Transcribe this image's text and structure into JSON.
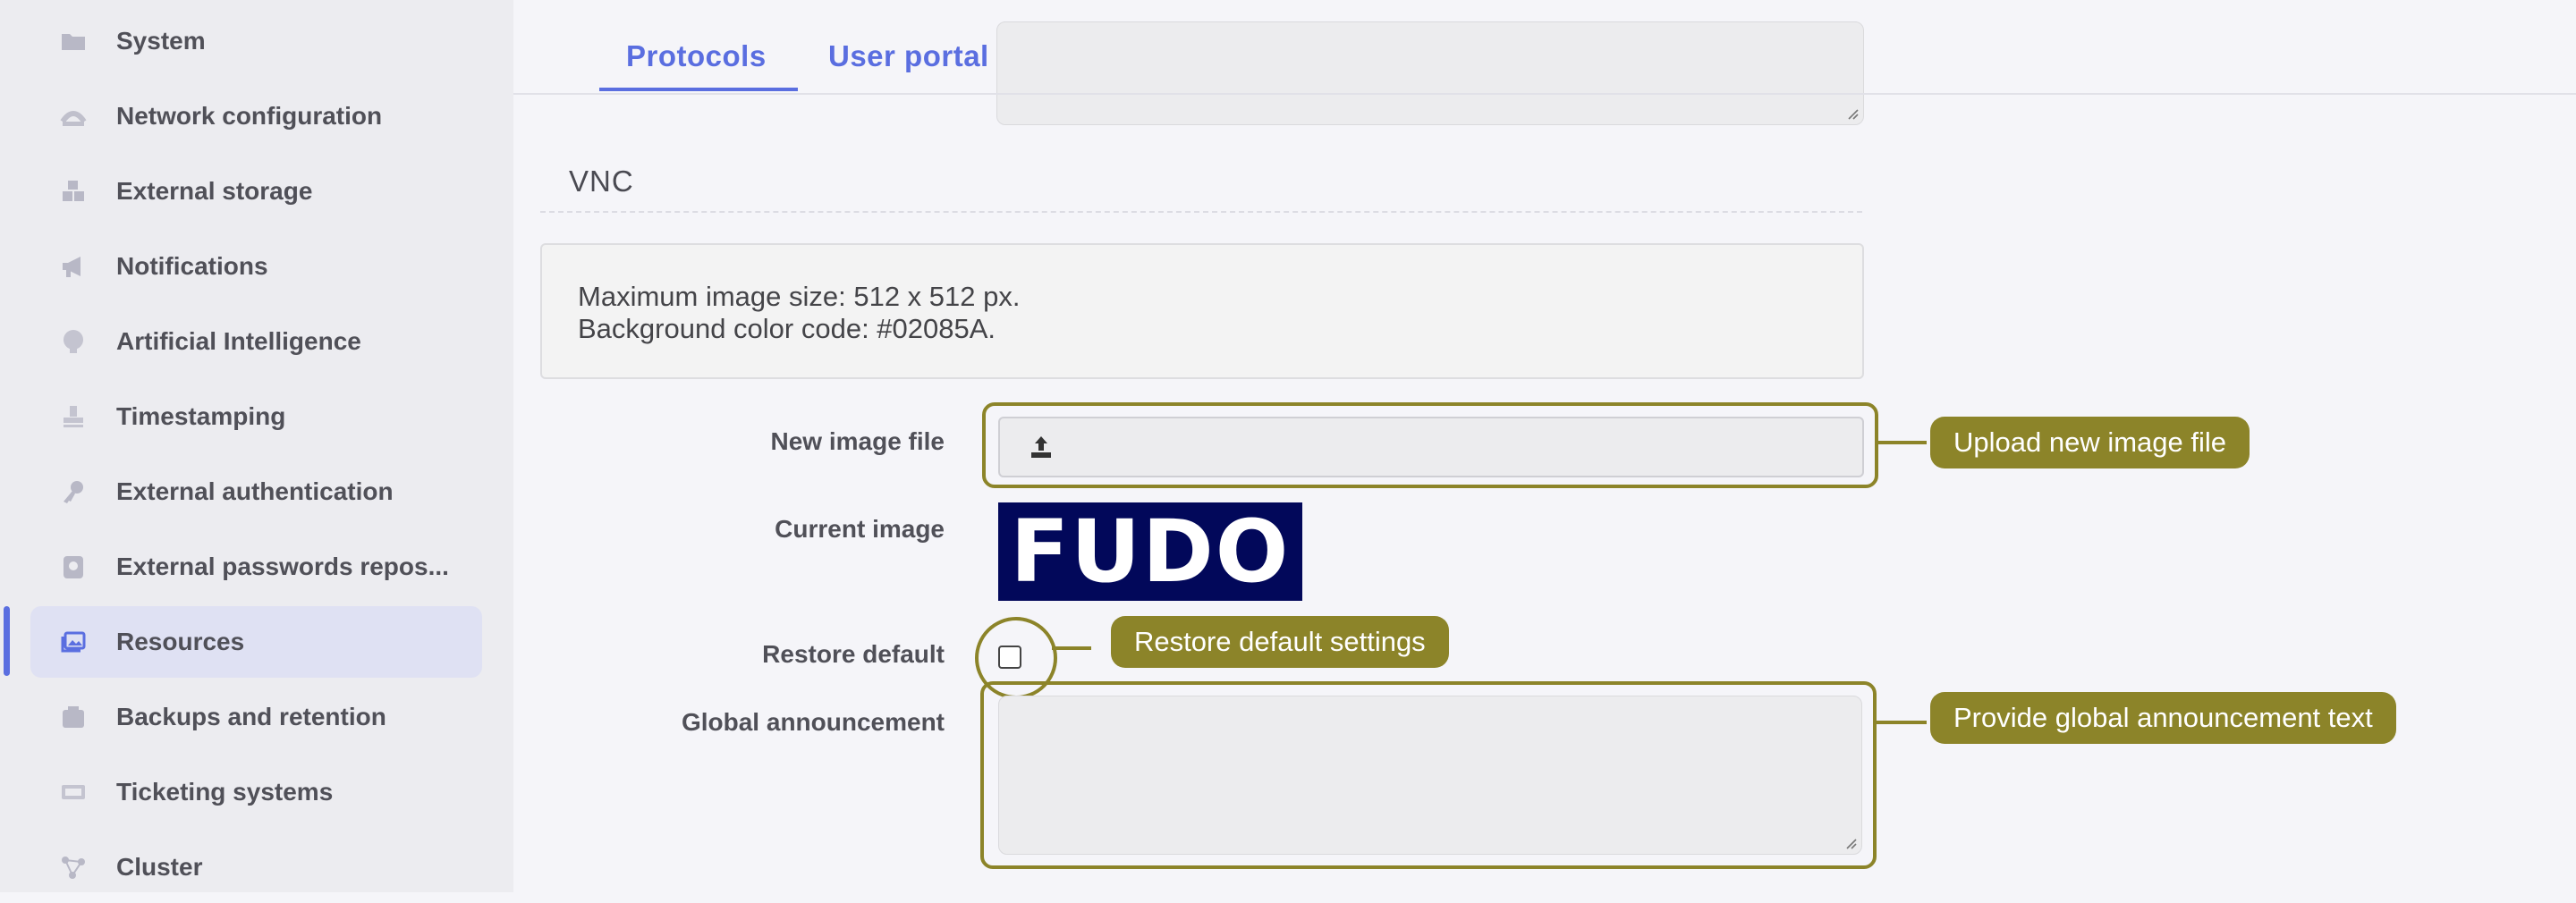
{
  "sidebar": {
    "items": [
      {
        "label": "System",
        "icon": "folder-icon",
        "active": false
      },
      {
        "label": "Network configuration",
        "icon": "network-icon",
        "active": false
      },
      {
        "label": "External storage",
        "icon": "storage-icon",
        "active": false
      },
      {
        "label": "Notifications",
        "icon": "megaphone-icon",
        "active": false
      },
      {
        "label": "Artificial Intelligence",
        "icon": "brain-icon",
        "active": false
      },
      {
        "label": "Timestamping",
        "icon": "stamp-icon",
        "active": false
      },
      {
        "label": "External authentication",
        "icon": "key-icon",
        "active": false
      },
      {
        "label": "External passwords repos...",
        "icon": "vault-icon",
        "active": false
      },
      {
        "label": "Resources",
        "icon": "image-gallery-icon",
        "active": true
      },
      {
        "label": "Backups and retention",
        "icon": "backup-icon",
        "active": false
      },
      {
        "label": "Ticketing systems",
        "icon": "ticket-icon",
        "active": false
      },
      {
        "label": "Cluster",
        "icon": "cluster-icon",
        "active": false
      }
    ]
  },
  "tabs": [
    {
      "label": "Protocols",
      "active": true
    },
    {
      "label": "User portal",
      "active": false
    }
  ],
  "section": {
    "title": "VNC",
    "info_lines": [
      "Maximum image size: 512 x 512 px.",
      "Background color code: #02085A."
    ]
  },
  "form": {
    "new_image_label": "New image file",
    "current_image_label": "Current image",
    "current_image_text": "FUDO",
    "restore_label": "Restore default",
    "restore_checked": false,
    "announcement_label": "Global announcement",
    "announcement_value": ""
  },
  "annotations": {
    "upload": "Upload new image file",
    "restore": "Restore default settings",
    "announcement": "Provide global announcement text"
  },
  "colors": {
    "accent": "#5a6ee0",
    "annotation": "#8c8429",
    "image_background": "#02085A",
    "sidebar_bg": "#ececf0",
    "active_item_bg": "#dfe1f3"
  }
}
